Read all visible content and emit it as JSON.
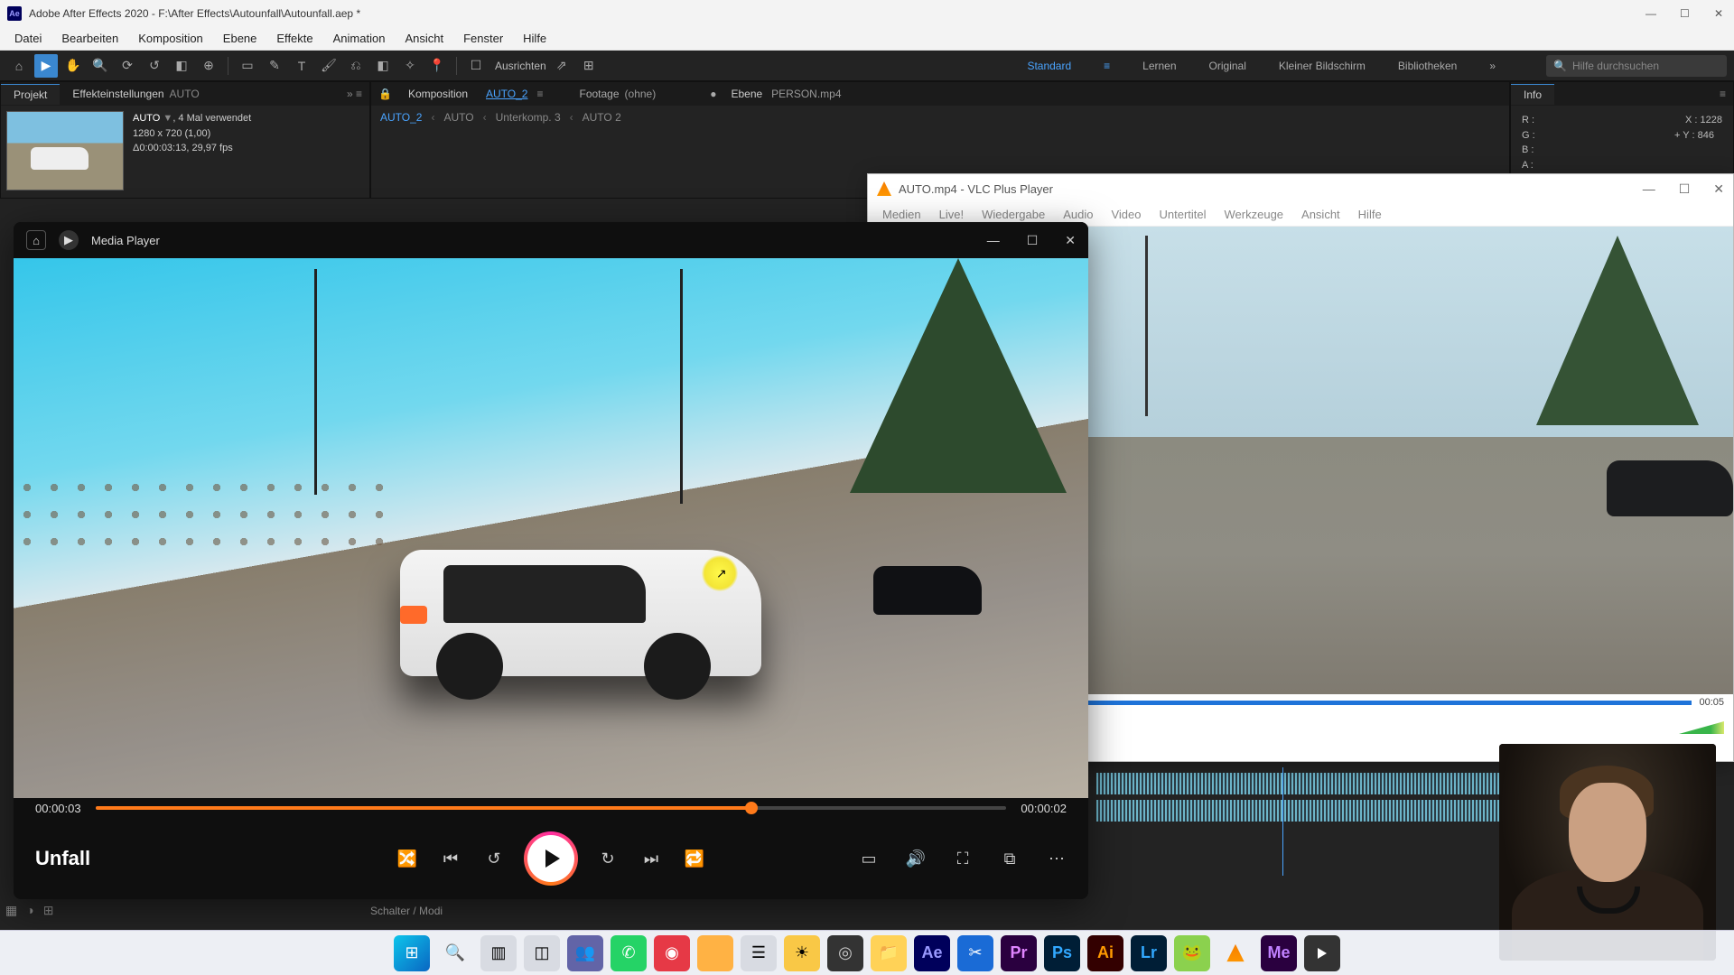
{
  "ae": {
    "title": "Adobe After Effects 2020 - F:\\After Effects\\Autounfall\\Autounfall.aep *",
    "menu": [
      "Datei",
      "Bearbeiten",
      "Komposition",
      "Ebene",
      "Effekte",
      "Animation",
      "Ansicht",
      "Fenster",
      "Hilfe"
    ],
    "toolbar": {
      "align": "Ausrichten",
      "workspaces": [
        "Standard",
        "Lernen",
        "Original",
        "Kleiner Bildschirm",
        "Bibliotheken"
      ],
      "active_workspace": "Standard",
      "search_placeholder": "Hilfe durchsuchen"
    },
    "project": {
      "tab": "Projekt",
      "effects_label": "Effekteinstellungen",
      "effects_target": "AUTO",
      "clip_name": "AUTO",
      "usage": ", 4 Mal verwendet",
      "res": "1280 x 720 (1,00)",
      "dur": "Δ0:00:03:13, 29,97 fps"
    },
    "comp": {
      "label": "Komposition",
      "current": "AUTO_2",
      "footage_label": "Footage",
      "footage_val": "(ohne)",
      "layer_label": "Ebene",
      "layer_val": "PERSON.mp4",
      "breadcrumb": [
        "AUTO_2",
        "AUTO",
        "Unterkomp. 3",
        "AUTO 2"
      ]
    },
    "info": {
      "tab": "Info",
      "r": "R :",
      "g": "G :",
      "b": "B :",
      "a": "A :",
      "x": "X : 1228",
      "y": "Y : 846"
    },
    "schalter": "Schalter / Modi"
  },
  "vlc": {
    "title": "AUTO.mp4 - VLC Plus Player",
    "menu": [
      "Medien",
      "Live!",
      "Wiedergabe",
      "Audio",
      "Video",
      "Untertitel",
      "Werkzeuge",
      "Ansicht",
      "Hilfe"
    ],
    "time_total": "00:05"
  },
  "mp": {
    "title": "Media Player",
    "elapsed": "00:00:03",
    "remaining": "00:00:02",
    "name": "Unfall",
    "icons": {
      "shuffle": "shuffle",
      "prev": "prev",
      "back10": "back10",
      "play": "play",
      "fwd30": "fwd30",
      "next": "next",
      "repeat": "repeat",
      "cc": "cc",
      "vol": "vol",
      "full": "full",
      "mini": "mini",
      "more": "more"
    }
  },
  "taskbar": {
    "items": [
      "windows",
      "search",
      "taskview",
      "widgets",
      "teams",
      "whatsapp",
      "mail",
      "firefox",
      "app1",
      "app2",
      "obs",
      "folder",
      "ae",
      "app3",
      "pr",
      "ps",
      "ai",
      "lr",
      "app4",
      "vlc",
      "me",
      "mediaplayer"
    ]
  }
}
